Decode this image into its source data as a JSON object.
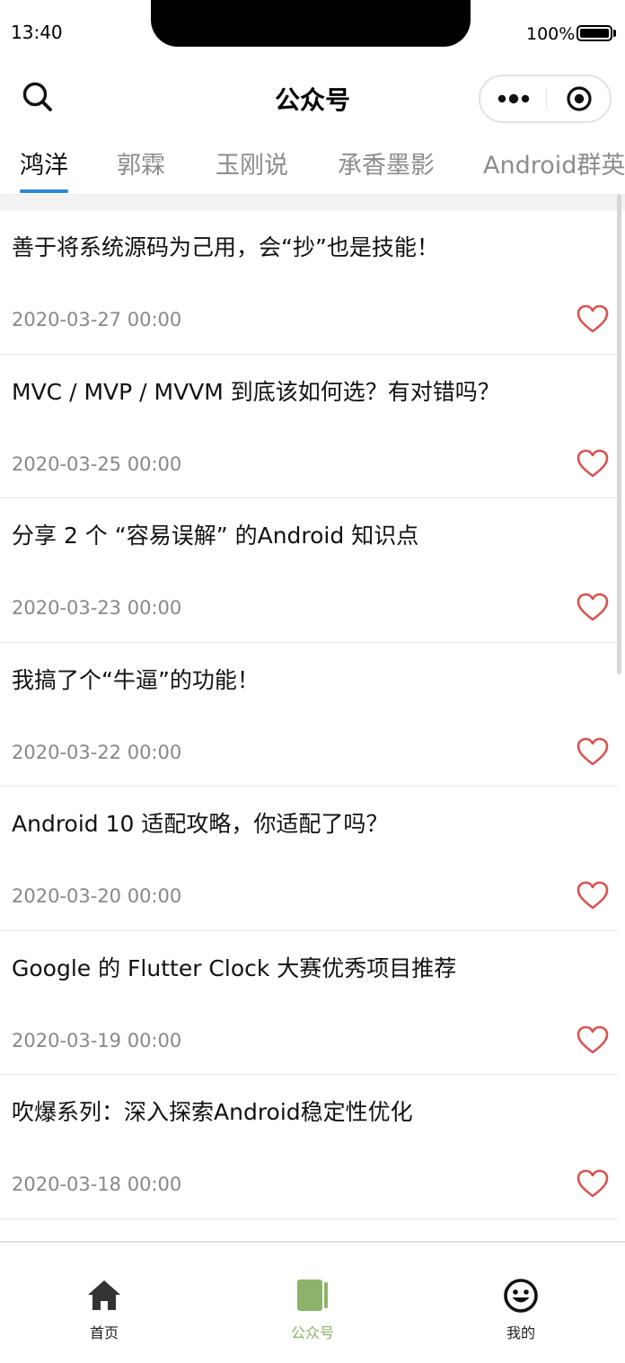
{
  "status_bar": {
    "time": "13:40",
    "battery_percent": "100%",
    "battery_level": 1.0
  },
  "nav": {
    "title": "公众号",
    "search_icon": "search-icon",
    "more_icon": "more-dots-icon",
    "close_icon": "target-close-icon"
  },
  "tabs": [
    {
      "label": "鸿洋",
      "active": true
    },
    {
      "label": "郭霖",
      "active": false
    },
    {
      "label": "玉刚说",
      "active": false
    },
    {
      "label": "承香墨影",
      "active": false
    },
    {
      "label": "Android群英传",
      "active": false
    }
  ],
  "articles": [
    {
      "title": "善于将系统源码为己用，会“抄”也是技能！",
      "date": "2020-03-27 00:00",
      "favorite": false
    },
    {
      "title": "MVC / MVP / MVVM 到底该如何选？有对错吗？",
      "date": "2020-03-25 00:00",
      "favorite": false
    },
    {
      "title": "分享 2 个 “容易误解” 的Android 知识点",
      "date": "2020-03-23 00:00",
      "favorite": false
    },
    {
      "title": "我搞了个“牛逼”的功能！",
      "date": "2020-03-22 00:00",
      "favorite": false
    },
    {
      "title": "Android 10 适配攻略，你适配了吗？",
      "date": "2020-03-20 00:00",
      "favorite": false
    },
    {
      "title": "Google 的 Flutter Clock 大赛优秀项目推荐",
      "date": "2020-03-19 00:00",
      "favorite": false
    },
    {
      "title": "吹爆系列：深入探索Android稳定性优化",
      "date": "2020-03-18 00:00",
      "favorite": false
    }
  ],
  "tab_bar": {
    "items": [
      {
        "label": "首页",
        "icon": "home-icon",
        "active": false
      },
      {
        "label": "公众号",
        "icon": "book-icon",
        "active": true
      },
      {
        "label": "我的",
        "icon": "smiley-icon",
        "active": false
      }
    ]
  },
  "colors": {
    "tab_underline": "#2f86d4",
    "heart": "#d9534f",
    "tab_bar_active": "#8db26a"
  }
}
